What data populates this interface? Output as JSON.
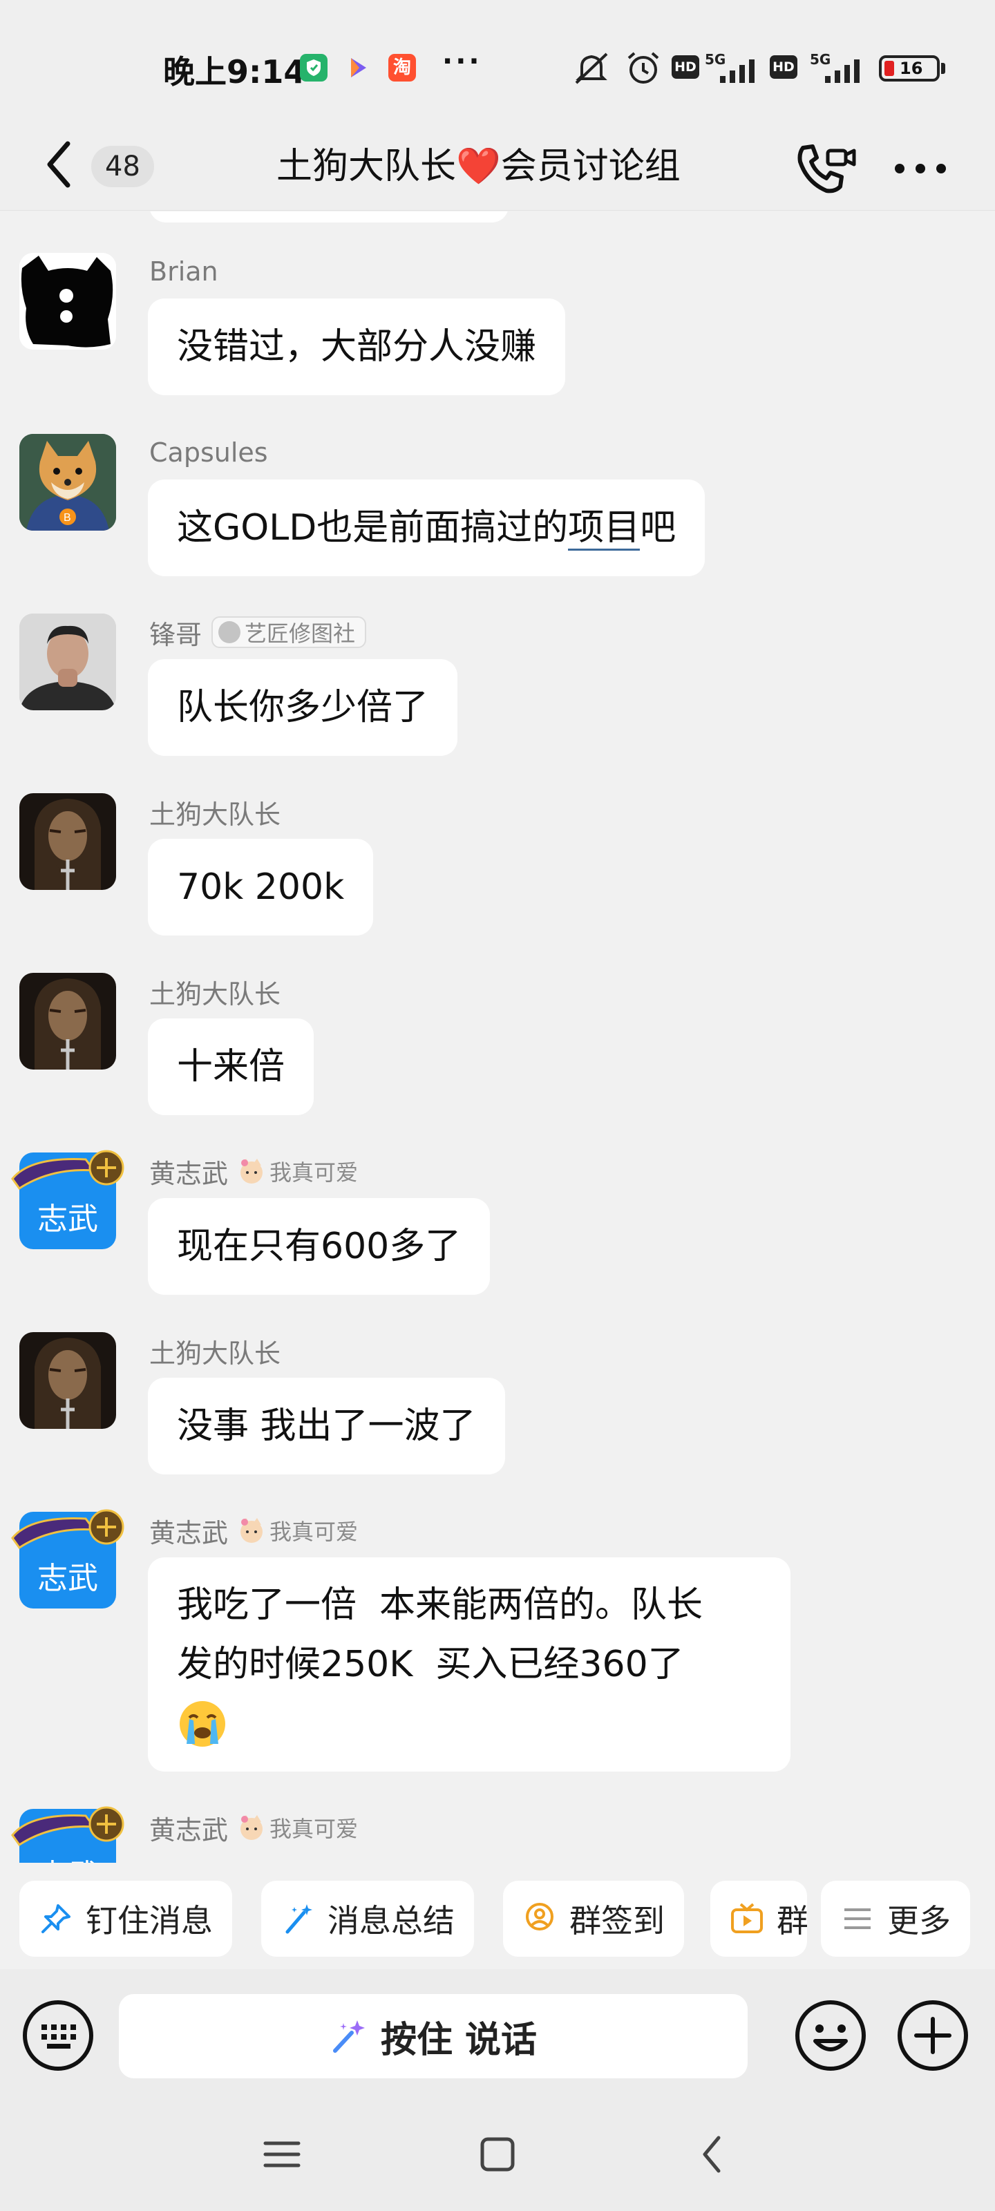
{
  "status_bar": {
    "time": "晚上9:14",
    "app_icons": [
      "shield-app-icon",
      "play-app-icon",
      "taobao-app-icon"
    ],
    "taobao_glyph": "淘",
    "more": "···",
    "network": "5G",
    "hd": "HD",
    "battery": "16",
    "colors": {
      "battery_low": "#e02020"
    }
  },
  "header": {
    "unread_count": "48",
    "title": "土狗大队长❤️会员讨论组"
  },
  "messages": [
    {
      "sender": "Brian",
      "text": "没错过，大部分人没赚",
      "avatar": "black-cat-avatar"
    },
    {
      "sender": "Capsules",
      "text_before": "这GOLD也是前面搞过的",
      "text_underlined": "项目",
      "text_after": "吧",
      "avatar": "shiba-hoodie-avatar"
    },
    {
      "sender": "锋哥",
      "tag": "艺匠修图社",
      "text": "队长你多少倍了",
      "avatar": "man-photo-avatar"
    },
    {
      "sender": "土狗大队长",
      "text": "70k 200k",
      "avatar": "warrior-avatar"
    },
    {
      "sender": "土狗大队长",
      "text": "十来倍",
      "avatar": "warrior-avatar"
    },
    {
      "sender": "黄志武",
      "title": "我真可爱",
      "text": "现在只有600多了",
      "avatar_name": "志武",
      "avatar_badge": "奇侠大师"
    },
    {
      "sender": "土狗大队长",
      "text": "没事 我出了一波了",
      "avatar": "warrior-avatar"
    },
    {
      "sender": "黄志武",
      "title": "我真可爱",
      "line1": "我吃了一倍  本来能两倍的。队长",
      "line2": "发的时候250K  买入已经360了",
      "emoji": "loudly-crying-emoji",
      "avatar_name": "志武",
      "avatar_badge": "奇侠大师"
    },
    {
      "sender": "黄志武",
      "title": "我真可爱",
      "avatar_name": "志武",
      "avatar_badge": "奇侠大师"
    }
  ],
  "quick_actions": [
    {
      "label": "钉住消息",
      "icon": "pin-icon"
    },
    {
      "label": "消息总结",
      "icon": "magic-wand-icon"
    },
    {
      "label": "群签到",
      "icon": "location-pin-icon"
    },
    {
      "label": "群",
      "icon": "tv-icon"
    },
    {
      "label": "更多",
      "icon": "menu-icon"
    }
  ],
  "input": {
    "voice_label": "按住 说话"
  },
  "colors": {
    "avatar_blue": "#1a8ff0",
    "icon_blue": "#1a8ff0",
    "icon_orange": "#f0a020"
  }
}
